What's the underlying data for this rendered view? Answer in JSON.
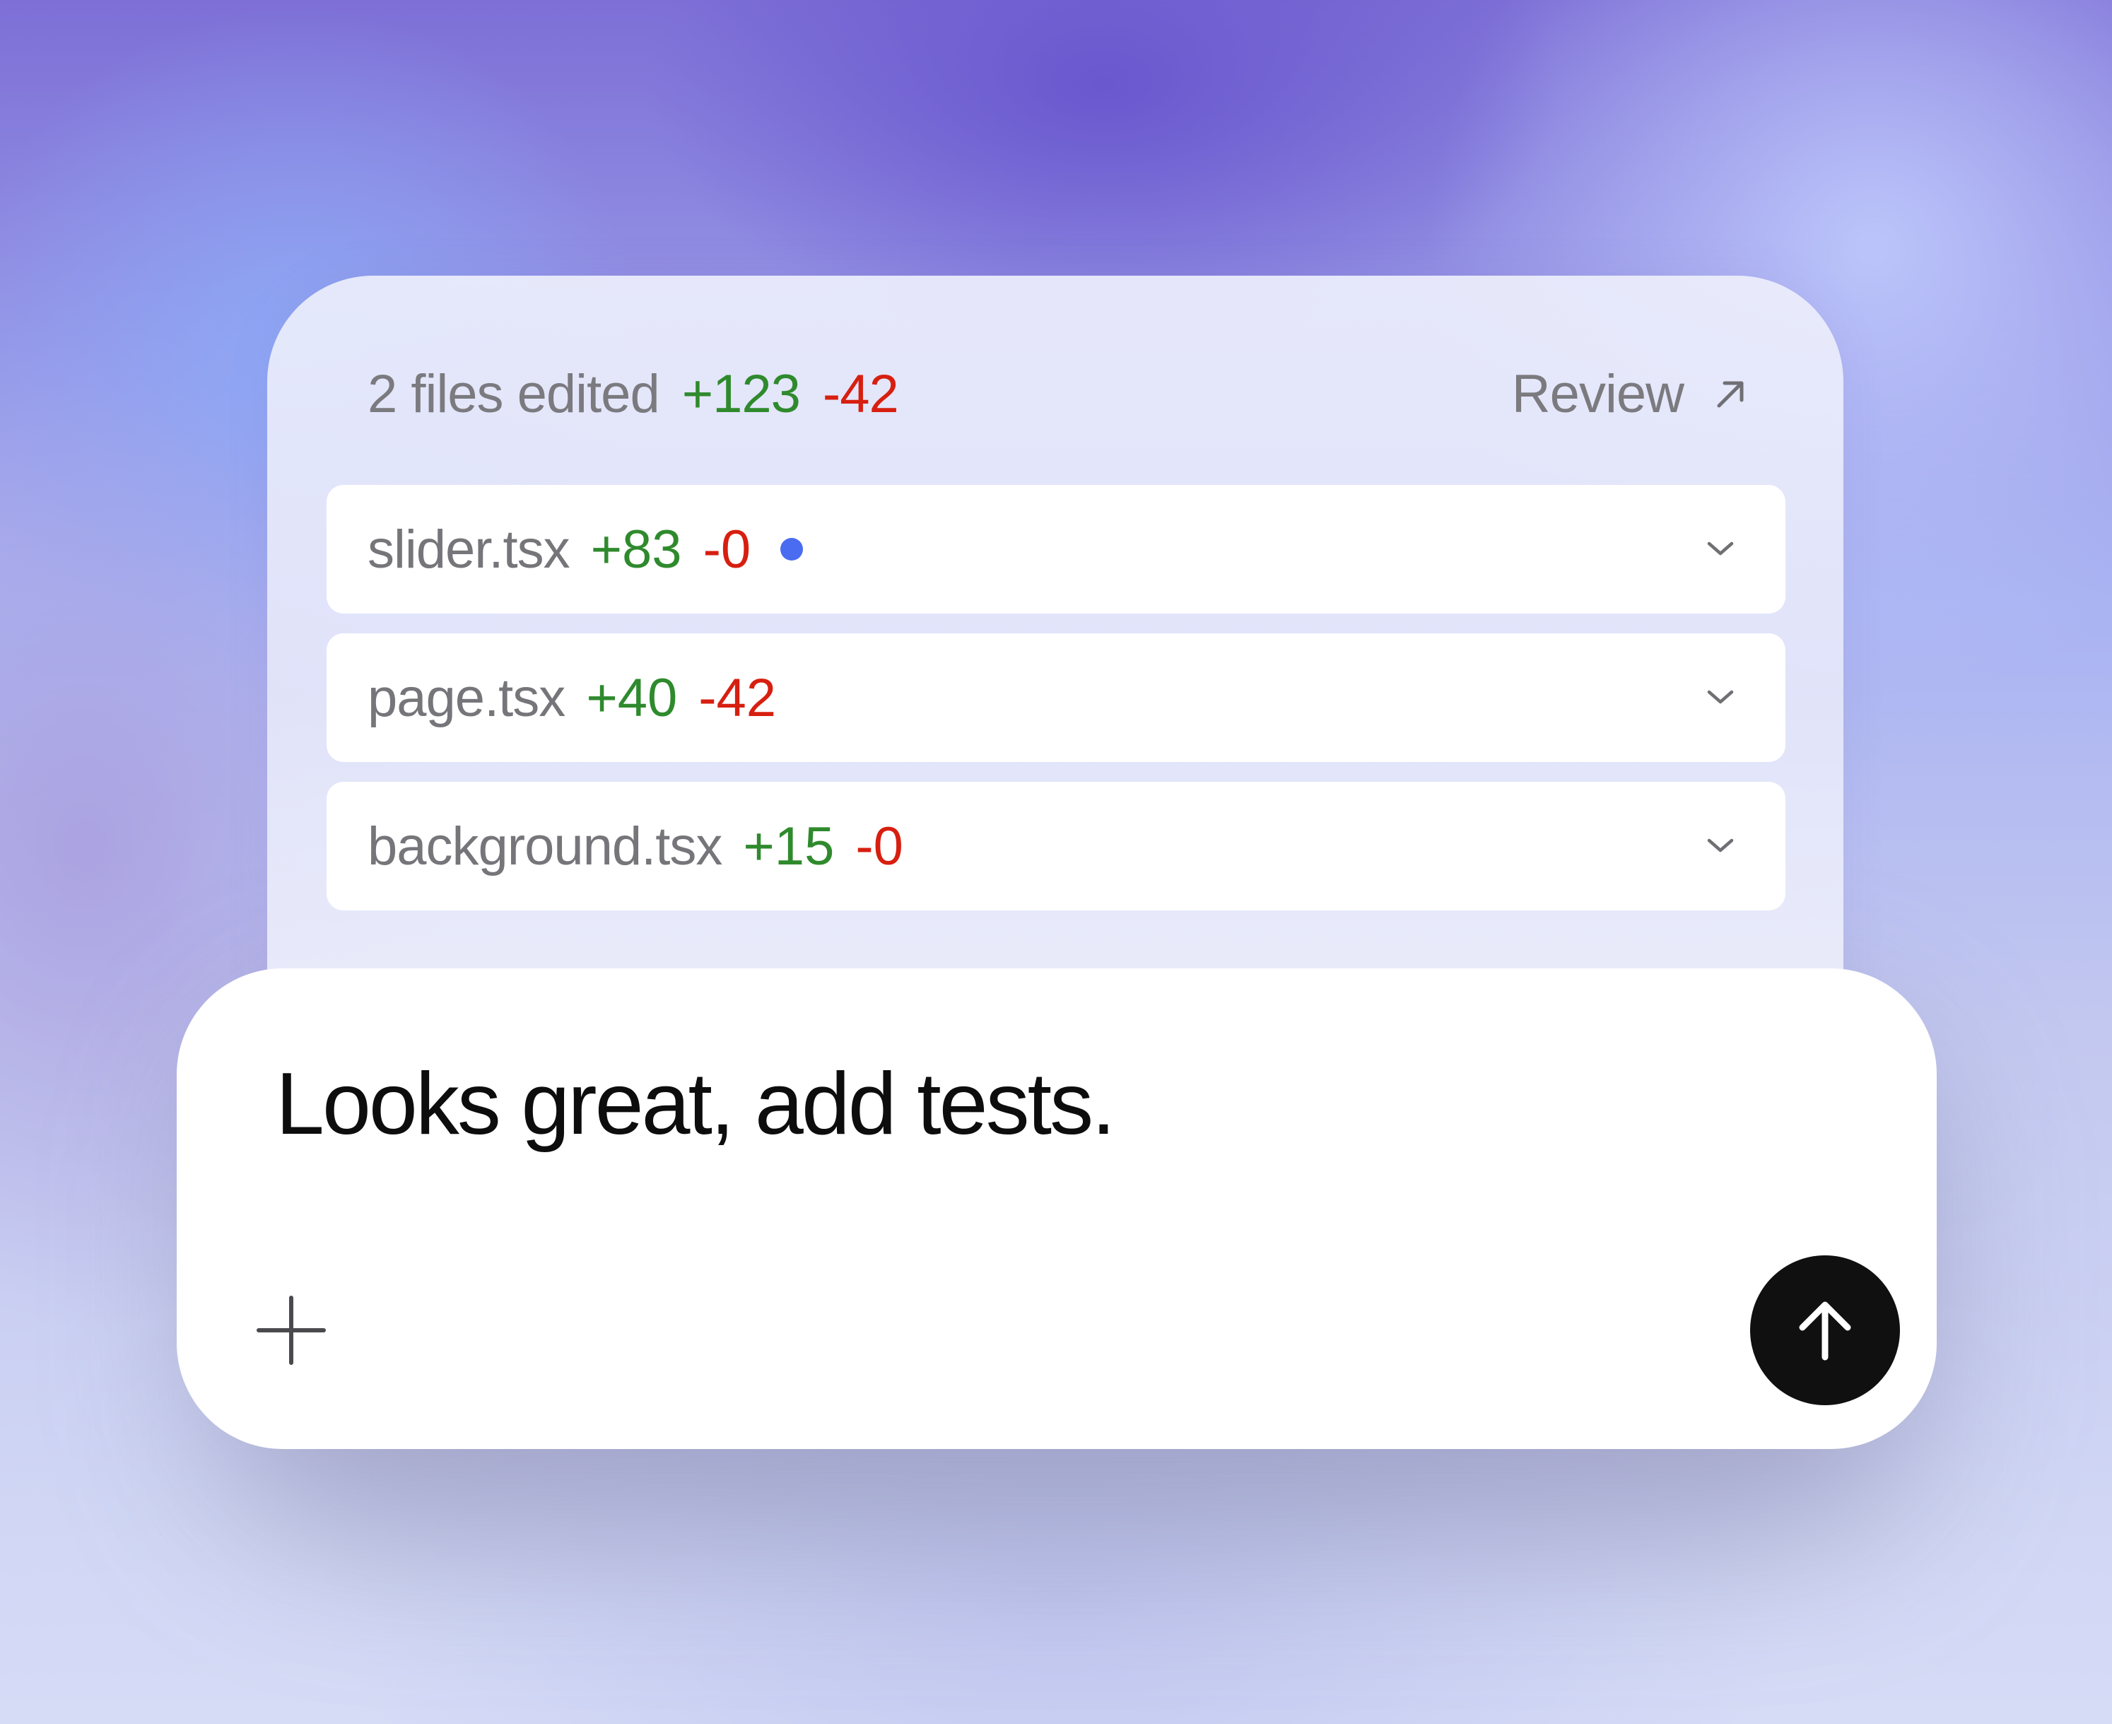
{
  "summary": {
    "files_edited": "2 files edited",
    "additions": "+123",
    "deletions": "-42",
    "review_label": "Review",
    "review_icon": "arrow-up-right-icon"
  },
  "files": [
    {
      "name": "slider.tsx",
      "additions": "+83",
      "deletions": "-0",
      "unsaved_indicator": true
    },
    {
      "name": "page.tsx",
      "additions": "+40",
      "deletions": "-42",
      "unsaved_indicator": false
    },
    {
      "name": "background.tsx",
      "additions": "+15",
      "deletions": "-0",
      "unsaved_indicator": false
    }
  ],
  "composer": {
    "message": "Looks great, add tests.",
    "attach_icon": "plus-icon",
    "send_icon": "arrow-up-icon"
  },
  "colors": {
    "addition": "#2f8a2d",
    "deletion": "#d71f10",
    "indicator": "#4a6cf0",
    "send_button": "#101010"
  }
}
